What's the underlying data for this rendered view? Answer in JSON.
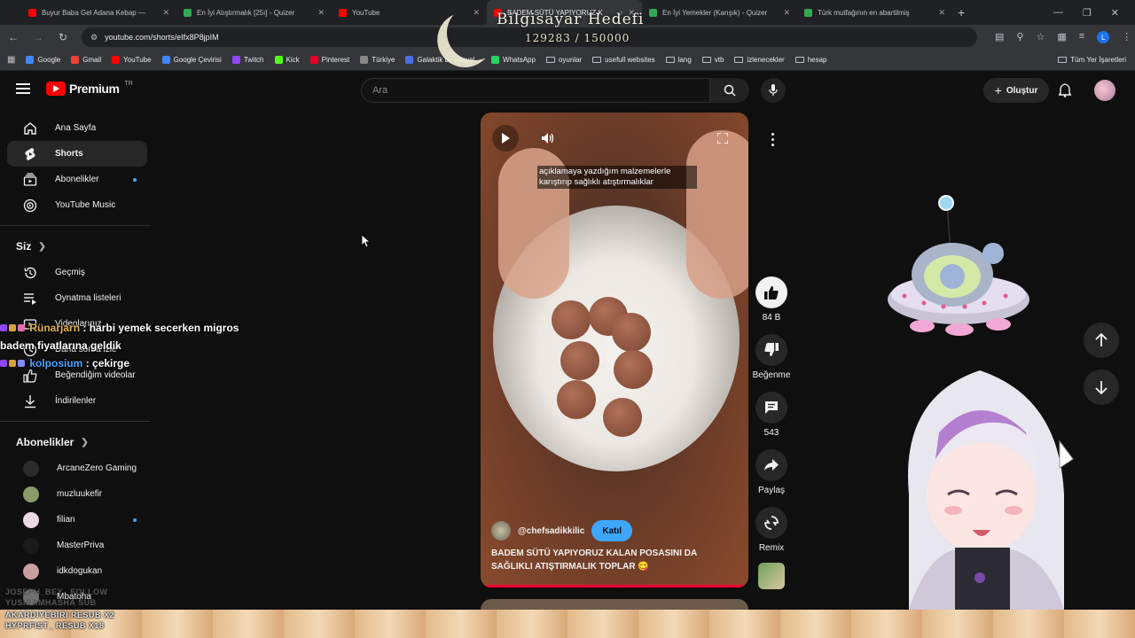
{
  "browser": {
    "tabs": [
      {
        "title": "Buyur Baba Gel Adana Kebap —",
        "color": "#ff0000",
        "active": false
      },
      {
        "title": "En İyi Atıştırmalık [25ı] - Quizer",
        "color": "#34a853",
        "active": false
      },
      {
        "title": "YouTube",
        "color": "#ff0000",
        "active": false
      },
      {
        "title": "BADEM SÜTÜ YAPIYORUZ K",
        "color": "#ff0000",
        "active": true
      },
      {
        "title": "En İyi Yemekler (Karışık) - Quizer",
        "color": "#34a853",
        "active": false
      },
      {
        "title": "Türk mutfağının en abartilmiş",
        "color": "#34a853",
        "active": false
      }
    ],
    "url": "youtube.com/shorts/eIfx8P8jpIM",
    "bookmarks": [
      "Google",
      "Gmail",
      "YouTube",
      "Google Çevirisi",
      "Twitch",
      "Kick",
      "Pinterest",
      "Türkiye",
      "Galaktik bir sosyal...",
      "WhatsApp",
      "oyunlar",
      "usefull websites",
      "lang",
      "vtb",
      "izlenecekler",
      "hesap"
    ],
    "bookmark_folders": [
      false,
      false,
      false,
      false,
      false,
      false,
      false,
      false,
      false,
      false,
      true,
      true,
      true,
      true,
      true,
      true
    ],
    "bookmarks_all": "Tüm Yer İşaretleri",
    "profile_letter": "L"
  },
  "overlay": {
    "title": "Bilgisayar Hedefi",
    "count": "129283 / 150000"
  },
  "masthead": {
    "logo_text": "Premium",
    "region": "TR",
    "search_placeholder": "Ara",
    "create_label": "Oluştur"
  },
  "sidebar": {
    "main": [
      {
        "label": "Ana Sayfa",
        "icon": "home-icon"
      },
      {
        "label": "Shorts",
        "icon": "shorts-icon",
        "active": true
      },
      {
        "label": "Abonelikler",
        "icon": "subscriptions-icon",
        "dot": true
      },
      {
        "label": "YouTube Music",
        "icon": "music-icon"
      }
    ],
    "you_title": "Siz",
    "you": [
      {
        "label": "Geçmiş",
        "icon": "history-icon"
      },
      {
        "label": "Oynatma listeleri",
        "icon": "playlist-icon"
      },
      {
        "label": "Videolarınız",
        "icon": "videos-icon"
      },
      {
        "label": "Daha sonra izle",
        "icon": "watch-later-icon"
      },
      {
        "label": "Beğendiğim videolar",
        "icon": "like-icon"
      },
      {
        "label": "İndirilenler",
        "icon": "download-icon"
      }
    ],
    "subs_title": "Abonelikler",
    "subs": [
      {
        "label": "ArcaneZero Gaming",
        "color": "#2b2b2b",
        "dot": false
      },
      {
        "label": "muzluukefir",
        "color": "#8a9a6a",
        "dot": false
      },
      {
        "label": "filian",
        "color": "#e8d8e8",
        "dot": true
      },
      {
        "label": "MasterPriva",
        "color": "#1a1a1a",
        "dot": false
      },
      {
        "label": "idkdogukan",
        "color": "#c9a0a0",
        "dot": false
      },
      {
        "label": "Mbatoha",
        "color": "#707070",
        "dot": false
      }
    ]
  },
  "chat": [
    {
      "user": "Rünarjarn",
      "message": ": harbi yemek secerken migros badem fiyatlarına geldik"
    },
    {
      "user": "kolposium",
      "message": ": çekirge"
    }
  ],
  "alerts": {
    "line1": "JOSEPH_BEY_ FOLLOW",
    "line2": "YUSIRAMHASHA SUB",
    "line3": "AKARDIYEBIRI RESUB X2",
    "line4": "HYPRFIST_ RESUB X18"
  },
  "short": {
    "caption": "açıklamaya yazdığım malzemelerle karıştırıp sağlıklı atıştırmalıklar",
    "channel": "@chefsadikkilic",
    "join_label": "Katıl",
    "title": "BADEM SÜTÜ YAPIYORUZ KALAN POSASINI DA SAĞLIKLI ATIŞTIRMALIK TOPLAR 😋",
    "progress": 0.99
  },
  "actions": {
    "likes": "84 B",
    "dislike_label": "Beğenme",
    "comments": "543",
    "share_label": "Paylaş",
    "remix_label": "Remix"
  },
  "colors": {
    "accent": "#3ea6ff",
    "brand_red": "#ff0000",
    "progress": "#ff0033"
  }
}
